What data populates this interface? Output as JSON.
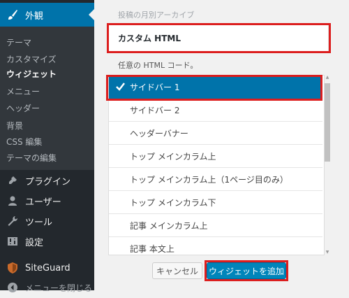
{
  "sidebar": {
    "active_menu": {
      "label": "外観",
      "icon": "paintbrush-icon"
    },
    "submenu": [
      {
        "label": "テーマ",
        "current": false
      },
      {
        "label": "カスタマイズ",
        "current": false
      },
      {
        "label": "ウィジェット",
        "current": true
      },
      {
        "label": "メニュー",
        "current": false
      },
      {
        "label": "ヘッダー",
        "current": false
      },
      {
        "label": "背景",
        "current": false
      },
      {
        "label": "CSS 編集",
        "current": false
      },
      {
        "label": "テーマの編集",
        "current": false
      }
    ],
    "menu": [
      {
        "label": "プラグイン",
        "icon": "plugin-icon"
      },
      {
        "label": "ユーザー",
        "icon": "user-icon"
      },
      {
        "label": "ツール",
        "icon": "wrench-icon"
      },
      {
        "label": "設定",
        "icon": "settings-icon"
      },
      {
        "label": "SiteGuard",
        "icon": "siteguard-icon"
      }
    ],
    "collapse_label": "メニューを閉じる"
  },
  "content": {
    "archive_label": "投稿の月別アーカイブ",
    "widget_title": "カスタム HTML",
    "description": "任意の HTML コード。",
    "areas": [
      {
        "label": "サイドバー 1",
        "selected": true
      },
      {
        "label": "サイドバー 2",
        "selected": false
      },
      {
        "label": "ヘッダーバナー",
        "selected": false
      },
      {
        "label": "トップ メインカラム上",
        "selected": false
      },
      {
        "label": "トップ メインカラム上（1ページ目のみ）",
        "selected": false
      },
      {
        "label": "トップ メインカラム下",
        "selected": false
      },
      {
        "label": "記事 メインカラム上",
        "selected": false
      },
      {
        "label": "記事 本文上",
        "selected": false
      }
    ],
    "cancel_label": "キャンセル",
    "add_label": "ウィジェットを追加"
  },
  "colors": {
    "sidebar_bg": "#23282d",
    "submenu_bg": "#32373c",
    "accent": "#0073aa",
    "highlight_outline": "#dc1e1e"
  }
}
